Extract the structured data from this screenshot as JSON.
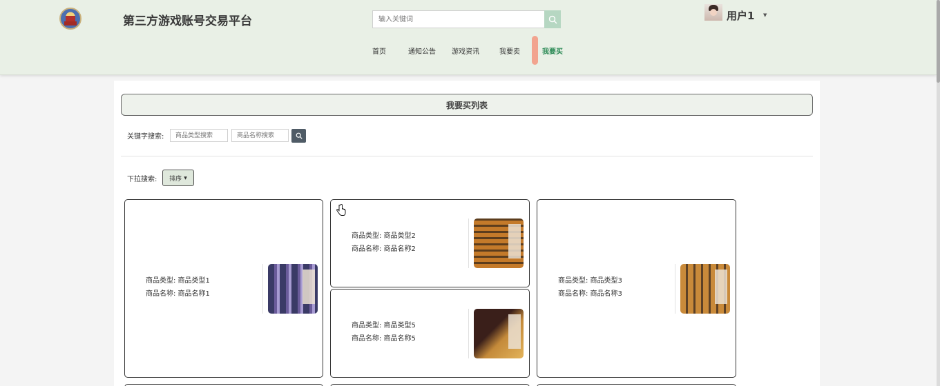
{
  "header": {
    "site_title": "第三方游戏账号交易平台",
    "search_placeholder": "输入关键词",
    "username": "用户1",
    "nav": [
      {
        "label": "首页",
        "active": false
      },
      {
        "label": "通知公告",
        "active": false
      },
      {
        "label": "游戏资讯",
        "active": false
      },
      {
        "label": "我要卖",
        "active": false
      },
      {
        "label": "我要买",
        "active": true
      }
    ]
  },
  "main": {
    "list_title": "我要买列表",
    "keyword_label": "关键字搜索:",
    "type_placeholder": "商品类型搜索",
    "name_placeholder": "商品名称搜索",
    "dropdown_label": "下拉搜索:",
    "sort_label": "排序"
  },
  "products": [
    {
      "type_text": "商品类型: 商品类型1",
      "name_text": "商品名称: 商品名称1"
    },
    {
      "type_text": "商品类型: 商品类型2",
      "name_text": "商品名称: 商品名称2"
    },
    {
      "type_text": "商品类型: 商品类型3",
      "name_text": "商品名称: 商品名称3"
    },
    {
      "type_text": "商品类型: 商品类型5",
      "name_text": "商品名称: 商品名称5"
    }
  ],
  "icons": {
    "search": "search-icon",
    "sort_caret": "caret-down-icon",
    "user_caret": "caret-down-icon"
  },
  "colors": {
    "header_bg": "#e9f0e6",
    "active_nav": "#2e8b57",
    "nav_indicator": "#f2a48f",
    "search_button": "#b6d7c2"
  }
}
